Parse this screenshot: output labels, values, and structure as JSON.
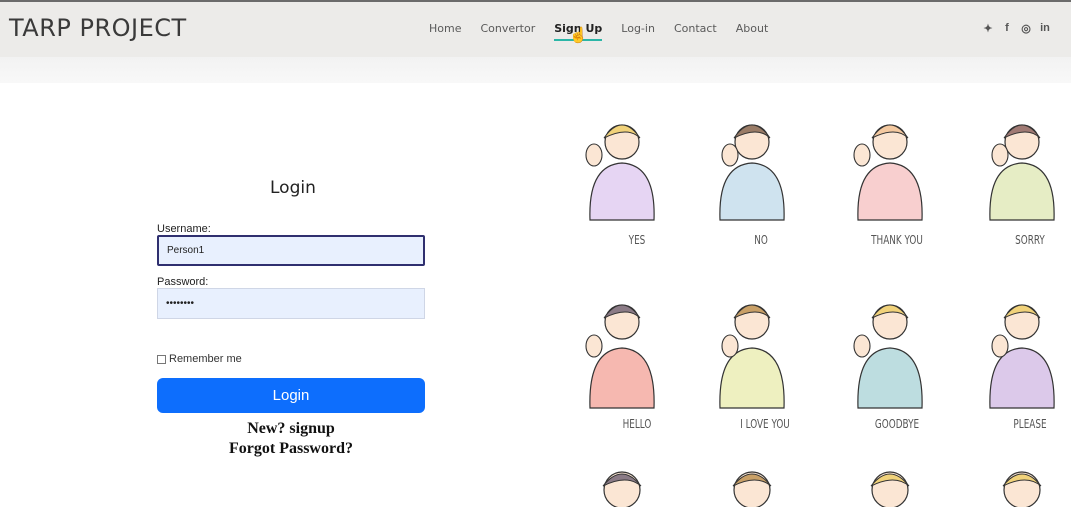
{
  "header": {
    "brand": "TARP PROJECT",
    "nav": [
      "Home",
      "Convertor",
      "Sign Up",
      "Log-in",
      "Contact",
      "About"
    ],
    "active_nav": "Sign Up",
    "social": [
      {
        "icon": "twitter-icon",
        "glyph": "✦"
      },
      {
        "icon": "facebook-icon",
        "glyph": "f"
      },
      {
        "icon": "instagram-icon",
        "glyph": "◎"
      },
      {
        "icon": "linkedin-icon",
        "glyph": "in"
      }
    ]
  },
  "login": {
    "title": "Login",
    "username_label": "Username:",
    "username_value": "Person1",
    "password_label": "Password:",
    "password_value": "••••••••",
    "remember_label": "Remember me",
    "button_label": "Login",
    "signup_link": "New? signup",
    "forgot_link": "Forgot Password?"
  },
  "signs": {
    "row1": [
      "YES",
      "NO",
      "THANK YOU",
      "SORRY"
    ],
    "row2": [
      "HELLO",
      "I LOVE YOU",
      "GOODBYE",
      "PLEASE"
    ]
  },
  "colors": {
    "accent": "#2bb6a7",
    "button": "#0d6efd",
    "shirts": [
      "#e6d5f3",
      "#cfe3ef",
      "#f8cfcf",
      "#e6edc5",
      "#f6b8b0",
      "#eef0c0",
      "#bddde0",
      "#dcc9ea"
    ]
  }
}
